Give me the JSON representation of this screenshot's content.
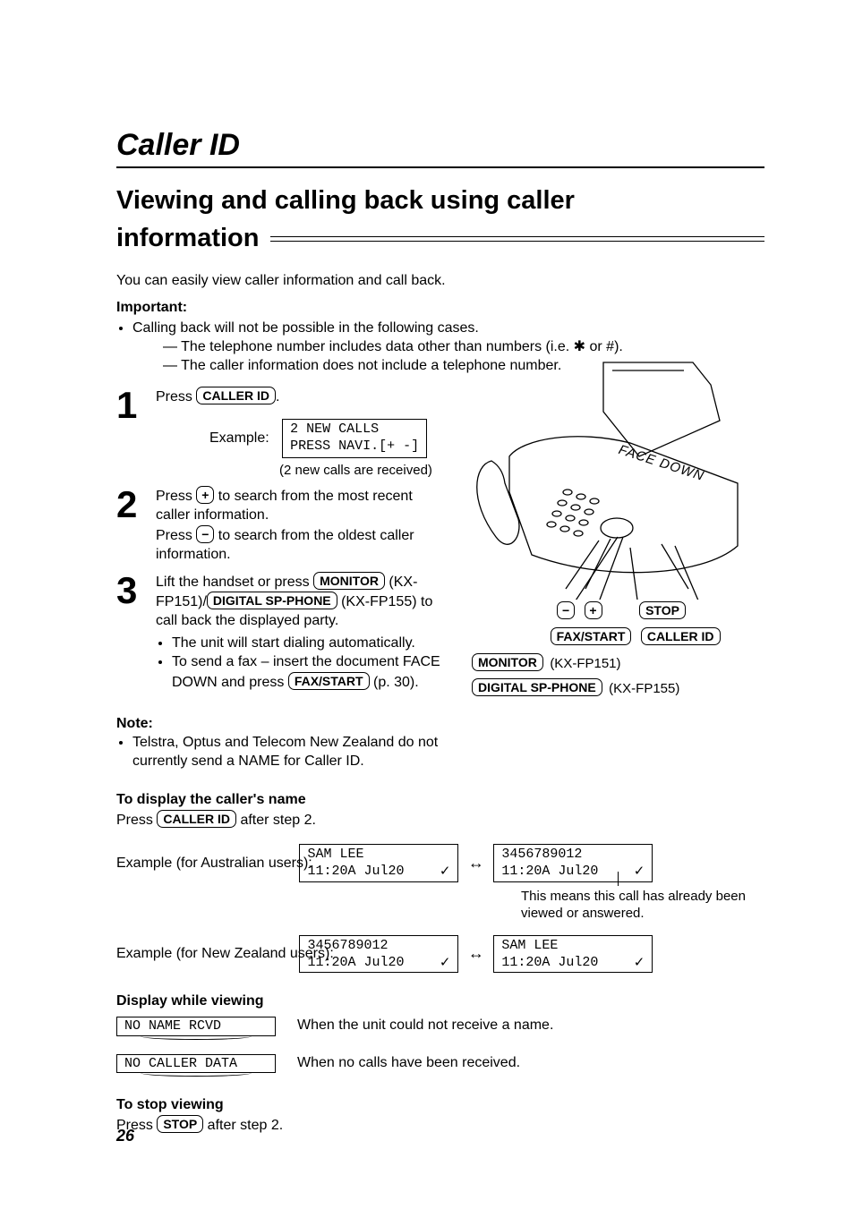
{
  "title": "Caller ID",
  "heading_line1": "Viewing and calling back using caller",
  "heading_line2": "information",
  "intro": "You can easily view caller information and call back.",
  "important_label": "Important:",
  "important_bullet": "Calling back will not be possible in the following cases.",
  "important_sub1": "The telephone number includes data other than numbers (i.e. ",
  "important_sub1_tail": " or #).",
  "important_sub2": "The caller information does not include a telephone number.",
  "step1": {
    "num": "1",
    "press": "Press ",
    "key": "CALLER ID",
    "dot": ".",
    "example_label": "Example:",
    "lcd_line1": "2 NEW CALLS",
    "lcd_line2": "PRESS NAVI.[+ -]",
    "caption": "(2 new calls are received)"
  },
  "step2": {
    "num": "2",
    "line1a": "Press ",
    "plus": "+",
    "line1b": " to search from the most recent caller information.",
    "line2a": "Press ",
    "minus": "−",
    "line2b": " to search from the oldest caller information."
  },
  "step3": {
    "num": "3",
    "line1a": "Lift the handset or press ",
    "monitor": "MONITOR",
    "line1b": " (KX-FP151)/",
    "dsp": "DIGITAL SP-PHONE",
    "line1c": " (KX-FP155) to call back the displayed party.",
    "b1": "The unit will start dialing automatically.",
    "b2a": "To send a fax – insert the document FACE DOWN and press ",
    "fax": "FAX/START",
    "b2b": " (p. 30)."
  },
  "note_heading": "Note:",
  "note_bullet": "Telstra, Optus and Telecom New Zealand do not currently send a NAME for Caller ID.",
  "caller_name": {
    "heading": "To display the caller's name",
    "press": "Press ",
    "key": "CALLER ID",
    "after": " after step 2.",
    "ex_au_label": "Example (for Australian users):",
    "ex_nz_label": "Example (for New Zealand users):",
    "lcd_name_l1": "SAM LEE",
    "lcd_name_l2": "11:20A Jul20",
    "lcd_num_l1": "3456789012",
    "lcd_num_l2": "11:20A Jul20",
    "check": "✓",
    "arrow": "↔",
    "check_note": "This means this call has already been viewed or answered."
  },
  "display_while": {
    "heading": "Display while viewing",
    "no_name": "NO NAME RCVD",
    "no_name_desc": "When the unit could not receive a name.",
    "no_data": "NO CALLER DATA",
    "no_data_desc": "When no calls have been received."
  },
  "stop_viewing": {
    "heading": "To stop viewing",
    "press": "Press ",
    "key": "STOP",
    "after": " after step 2."
  },
  "device": {
    "face_down": "FACE DOWN",
    "minus": "−",
    "plus": "+",
    "stop": "STOP",
    "fax": "FAX/START",
    "caller": "CALLER ID",
    "monitor": "MONITOR",
    "monitor_model": "(KX-FP151)",
    "dsp": "DIGITAL SP-PHONE",
    "dsp_model": "(KX-FP155)"
  },
  "page_num": "26"
}
